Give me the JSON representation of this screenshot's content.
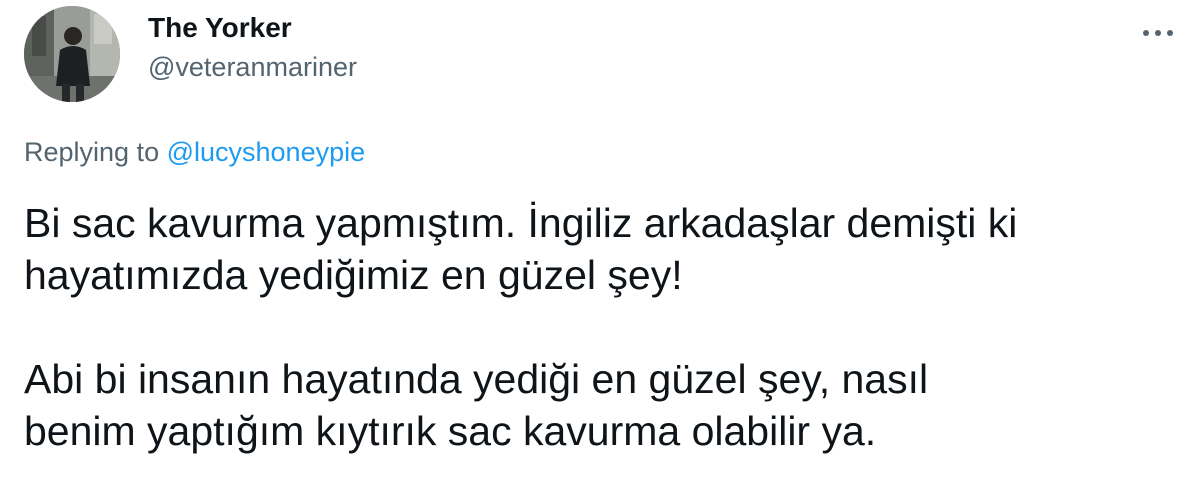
{
  "author": {
    "display_name": "The Yorker",
    "handle": "@veteranmariner",
    "avatar_icon": "profile-photo"
  },
  "menu": {
    "more_icon": "more-horizontal-icon"
  },
  "reply": {
    "prefix": "Replying to ",
    "mention": "@lucyshoneypie"
  },
  "text": {
    "paragraph1": [
      "Bi sac kavurma yapmıştım. İngiliz arkadaşlar demişti ki",
      "hayatımızda yediğimiz en güzel şey!"
    ],
    "paragraph2": [
      "Abi bi insanın hayatında yediği en güzel şey, nasıl",
      "benim yaptığım kıytırık sac kavurma olabilir ya."
    ]
  },
  "colors": {
    "text": "#0f1419",
    "secondary": "#536471",
    "link": "#1d9bf0"
  }
}
